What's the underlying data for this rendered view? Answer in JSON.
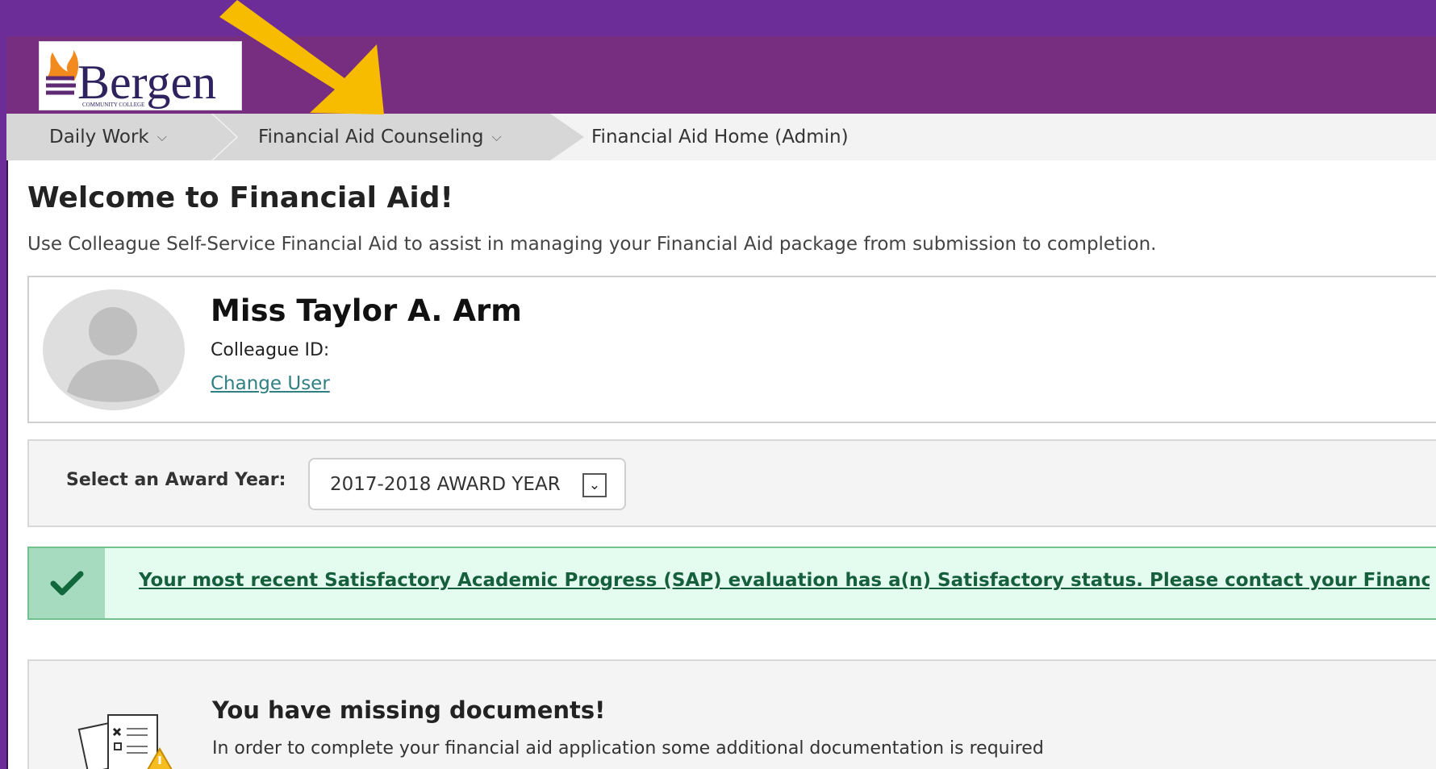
{
  "header": {
    "logo_text": "Bergen",
    "logo_subtitle": "COMMUNITY COLLEGE"
  },
  "breadcrumb": {
    "items": [
      {
        "label": "Daily Work"
      },
      {
        "label": "Financial Aid Counseling"
      },
      {
        "label": "Financial Aid Home (Admin)"
      }
    ]
  },
  "page": {
    "title": "Welcome to Financial Aid!",
    "intro": "Use Colleague Self-Service Financial Aid to assist in managing your Financial Aid package from submission to completion."
  },
  "person": {
    "name": "Miss Taylor A. Arm",
    "id_label": "Colleague ID:",
    "change_user": "Change User"
  },
  "award_year": {
    "label": "Select an Award Year:",
    "selected": "2017-2018 AWARD YEAR"
  },
  "sap_alert": {
    "text": "Your most recent Satisfactory Academic Progress (SAP) evaluation has a(n) Satisfactory status. Please contact your Financial"
  },
  "missing_docs": {
    "title": "You have missing documents!",
    "text": "In order to complete your financial aid application some additional documentation is required"
  },
  "colors": {
    "background_purple": "#6c2d98",
    "header_purple": "#772d80",
    "arrow_yellow": "#f7bb00",
    "success_green": "#72c28e"
  },
  "icons": {
    "arrow": "arrow-icon",
    "check": "check-icon",
    "document": "document-icon"
  }
}
